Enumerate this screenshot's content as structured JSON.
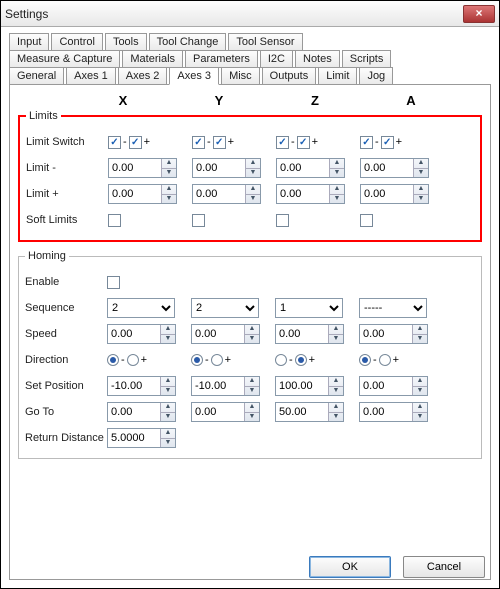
{
  "window": {
    "title": "Settings"
  },
  "tabs_row1": [
    "Input",
    "Control",
    "Tools",
    "Tool Change",
    "Tool Sensor"
  ],
  "tabs_row2": [
    "Measure & Capture",
    "Materials",
    "Parameters",
    "I2C",
    "Notes",
    "Scripts"
  ],
  "tabs_row3": [
    "General",
    "Axes 1",
    "Axes 2",
    "Axes 3",
    "Misc",
    "Outputs",
    "Limit",
    "Jog"
  ],
  "active_tab": "Axes 3",
  "axes": [
    "X",
    "Y",
    "Z",
    "A"
  ],
  "limits": {
    "legend": "Limits",
    "limit_switch_label": "Limit Switch",
    "limit_minus_label": "Limit -",
    "limit_plus_label": "Limit +",
    "soft_limits_label": "Soft Limits",
    "switch_minus": [
      true,
      true,
      true,
      true
    ],
    "switch_plus": [
      true,
      true,
      true,
      true
    ],
    "limit_minus": [
      "0.00",
      "0.00",
      "0.00",
      "0.00"
    ],
    "limit_plus": [
      "0.00",
      "0.00",
      "0.00",
      "0.00"
    ],
    "soft": [
      false,
      false,
      false,
      false
    ],
    "sign_minus": "-",
    "sign_plus": "+"
  },
  "homing": {
    "legend": "Homing",
    "enable_label": "Enable",
    "enable": false,
    "sequence_label": "Sequence",
    "sequence": [
      "2",
      "2",
      "1",
      "-----"
    ],
    "speed_label": "Speed",
    "speed": [
      "0.00",
      "0.00",
      "0.00",
      "0.00"
    ],
    "direction_label": "Direction",
    "direction": [
      "-",
      "-",
      "+",
      "-"
    ],
    "sign_minus": "-",
    "sign_plus": "+",
    "set_position_label": "Set Position",
    "set_position": [
      "-10.00",
      "-10.00",
      "100.00",
      "0.00"
    ],
    "goto_label": "Go To",
    "goto": [
      "0.00",
      "0.00",
      "50.00",
      "0.00"
    ],
    "return_distance_label": "Return Distance",
    "return_distance": "5.0000"
  },
  "buttons": {
    "ok": "OK",
    "cancel": "Cancel"
  }
}
